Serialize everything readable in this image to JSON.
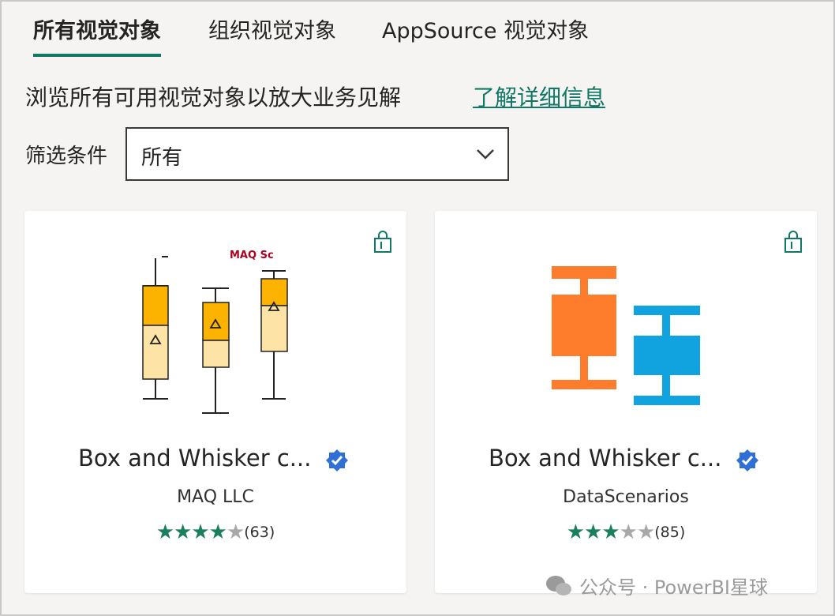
{
  "tabs": [
    {
      "label": "所有视觉对象",
      "active": true
    },
    {
      "label": "组织视觉对象",
      "active": false
    },
    {
      "label": "AppSource 视觉对象",
      "active": false
    }
  ],
  "description": "浏览所有可用视觉对象以放大业务见解",
  "learn_more": "了解详细信息",
  "filter": {
    "label": "筛选条件",
    "value": "所有",
    "icon": "chevron-down-icon"
  },
  "cards": [
    {
      "title": "Box and Whisker c...",
      "publisher": "MAQ LLC",
      "rating": 4,
      "rating_count": "(63)",
      "thumbnail_text": "MAQ Sc",
      "verified": true,
      "icon": "shopping-bag-icon"
    },
    {
      "title": "Box and Whisker c...",
      "publisher": "DataScenarios",
      "rating": 3,
      "rating_count": "(85)",
      "verified": true,
      "icon": "shopping-bag-icon"
    }
  ],
  "watermark": "公众号 · PowerBI星球",
  "colors": {
    "accent": "#117865",
    "star": "#1a7f5a",
    "verified": "#2f6fd6",
    "box_orange": "#fd7d2c",
    "box_blue": "#11a2e0",
    "box_yellow": "#fbb300",
    "box_light": "#fde4a6"
  }
}
